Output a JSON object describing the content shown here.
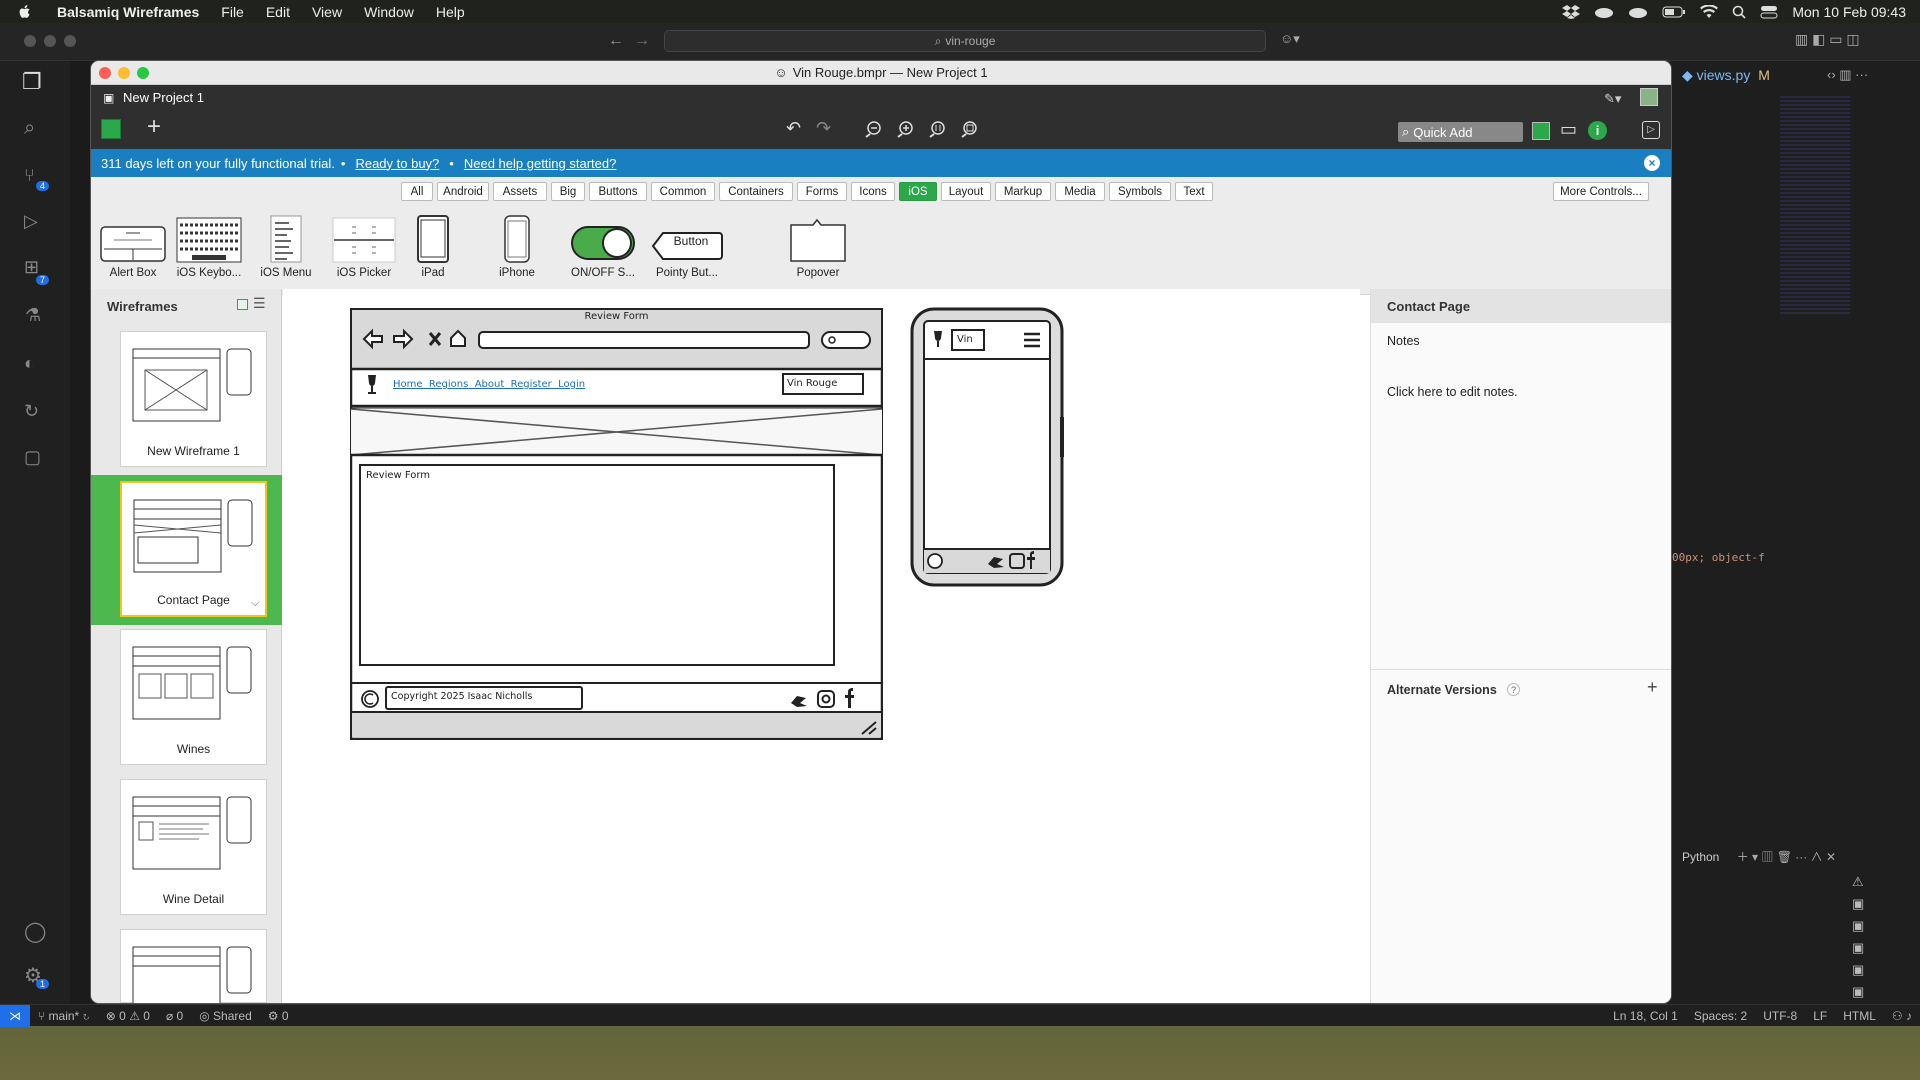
{
  "menubar": {
    "apple": "",
    "app": "Balsamiq Wireframes",
    "items": [
      "File",
      "Edit",
      "View",
      "Window",
      "Help"
    ],
    "clock": "Mon 10 Feb  09:43"
  },
  "vscode": {
    "search": "vin-rouge",
    "tab": "views.py",
    "tab_status": "M",
    "code_snippet": "00px; object-f",
    "terminal_label": "Python",
    "status": {
      "branch": "main*",
      "errors": "0",
      "warnings": "0",
      "ports": "0",
      "shared": "Shared",
      "net": "0",
      "position": "Ln 18, Col 1",
      "spaces": "Spaces: 2",
      "encoding": "UTF-8",
      "eol": "LF",
      "lang": "HTML"
    },
    "badges": {
      "scm": "4",
      "ext": "7",
      "settings": "1"
    }
  },
  "balsamiq": {
    "window_title": "Vin Rouge.bmpr — New Project 1",
    "project_name": "New Project 1",
    "quick_add_placeholder": "Quick Add",
    "banner": {
      "trial": "311 days left on your fully functional trial.",
      "sep": "•",
      "buy": "Ready to buy?",
      "help": "Need help getting started?"
    },
    "filters": [
      "All",
      "Android",
      "Assets",
      "Big",
      "Buttons",
      "Common",
      "Containers",
      "Forms",
      "Icons",
      "iOS",
      "Layout",
      "Markup",
      "Media",
      "Symbols",
      "Text"
    ],
    "active_filter": "iOS",
    "more_controls": "More Controls...",
    "library": [
      "Alert Box",
      "iOS Keybo...",
      "iOS Menu",
      "iOS Picker",
      "iPad",
      "iPhone",
      "ON/OFF S...",
      "Pointy But...",
      "Popover"
    ],
    "pointy_button_text": "Button",
    "wireframes_title": "Wireframes",
    "wireframes": [
      "New Wireframe 1",
      "Contact Page",
      "Wines",
      "Wine Detail",
      ""
    ],
    "selected_wireframe": "Contact Page",
    "canvas": {
      "browser_title": "Review Form",
      "nav_links": "Home  Regions  About  Register  Login",
      "brand_box": "Vin Rouge",
      "form_label": "Review Form",
      "copyright": "Copyright 2025 Isaac Nicholls",
      "phone_brand": "Vin"
    },
    "right_panel": {
      "title": "Contact Page",
      "notes_label": "Notes",
      "notes_hint": "Click here to edit notes.",
      "alt_versions": "Alternate Versions",
      "help_mark": "?"
    }
  }
}
